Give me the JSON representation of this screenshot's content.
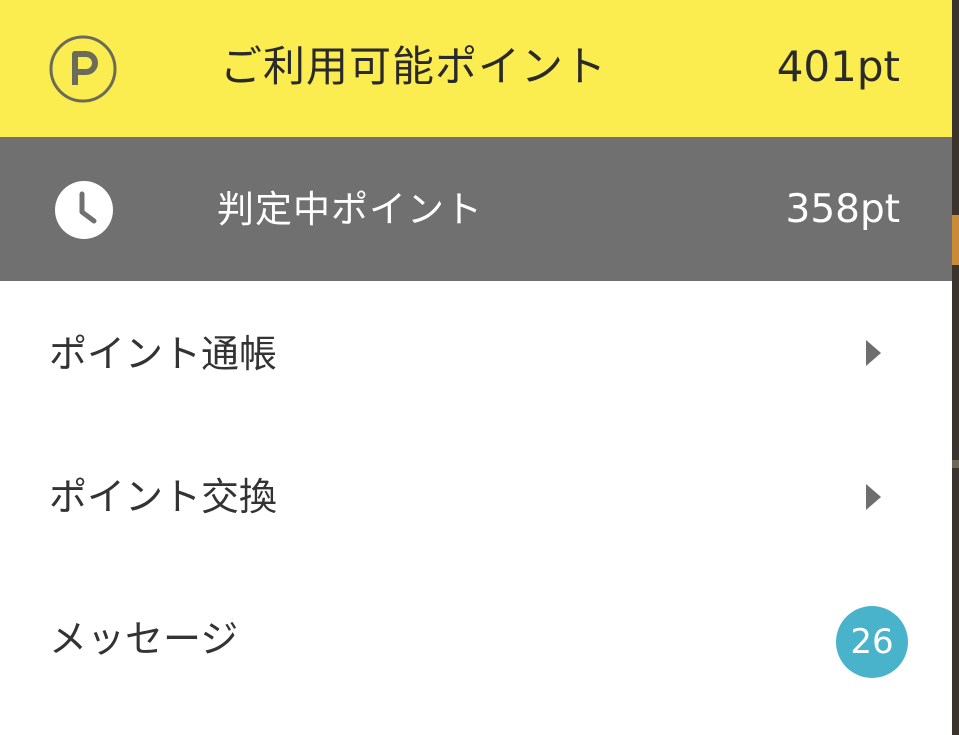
{
  "points": {
    "available": {
      "icon": "point-p-icon",
      "label": "ご利用可能ポイント",
      "value": "401pt",
      "bg_color": "#fbec4f"
    },
    "pending": {
      "icon": "clock-icon",
      "label": "判定中ポイント",
      "value": "358pt",
      "bg_color": "#707070"
    }
  },
  "menu": {
    "items": [
      {
        "label": "ポイント通帳",
        "icon": "chevron-right-icon"
      },
      {
        "label": "ポイント交換",
        "icon": "chevron-right-icon"
      },
      {
        "label": "メッセージ",
        "badge": "26",
        "badge_color": "#4ab3cc"
      }
    ]
  }
}
